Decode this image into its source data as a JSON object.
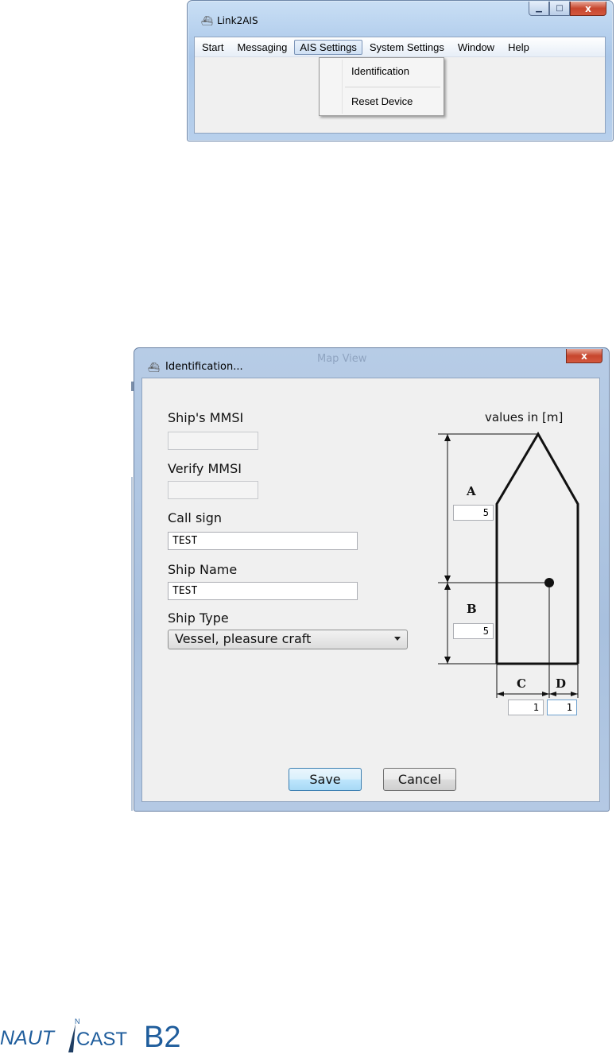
{
  "main_window": {
    "title": "Link2AIS",
    "menu": [
      "Start",
      "Messaging",
      "AIS Settings",
      "System Settings",
      "Window",
      "Help"
    ],
    "active_menu": "AIS Settings",
    "dropdown": [
      "Identification",
      "Reset Device"
    ],
    "close_glyph": "x"
  },
  "identification_dialog": {
    "title": "Identification...",
    "background_window_text": "Map View",
    "labels": {
      "mmsi": "Ship's MMSI",
      "verify_mmsi": "Verify MMSI",
      "call_sign": "Call sign",
      "ship_name": "Ship Name",
      "ship_type": "Ship Type"
    },
    "values": {
      "mmsi": "",
      "verify_mmsi": "",
      "call_sign": "TEST",
      "ship_name": "TEST",
      "ship_type": "Vessel, pleasure craft"
    },
    "diagram": {
      "units_note": "values in [m]",
      "A": {
        "label": "A",
        "value": "5"
      },
      "B": {
        "label": "B",
        "value": "5"
      },
      "C": {
        "label": "C",
        "value": "1"
      },
      "D": {
        "label": "D",
        "value": "1"
      }
    },
    "buttons": {
      "save": "Save",
      "cancel": "Cancel"
    }
  },
  "logo": {
    "part1": "NAUT",
    "north": "N",
    "part2": "CAST",
    "model": "B2"
  },
  "colors": {
    "logo_blue": "#1f5d9c",
    "close_red": "#c7462e"
  }
}
